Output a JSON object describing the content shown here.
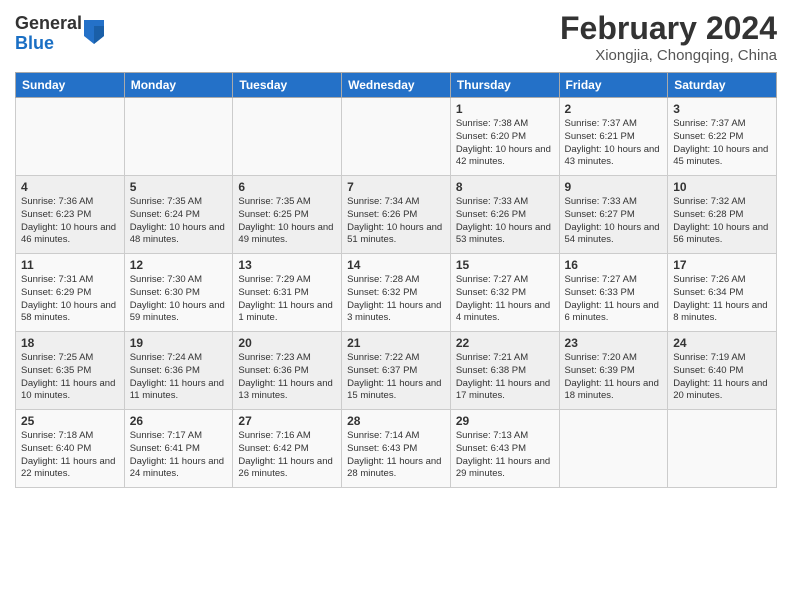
{
  "logo": {
    "text_general": "General",
    "text_blue": "Blue"
  },
  "header": {
    "title": "February 2024",
    "subtitle": "Xiongjia, Chongqing, China"
  },
  "weekdays": [
    "Sunday",
    "Monday",
    "Tuesday",
    "Wednesday",
    "Thursday",
    "Friday",
    "Saturday"
  ],
  "weeks": [
    [
      {
        "day": "",
        "info": ""
      },
      {
        "day": "",
        "info": ""
      },
      {
        "day": "",
        "info": ""
      },
      {
        "day": "",
        "info": ""
      },
      {
        "day": "1",
        "info": "Sunrise: 7:38 AM\nSunset: 6:20 PM\nDaylight: 10 hours and 42 minutes."
      },
      {
        "day": "2",
        "info": "Sunrise: 7:37 AM\nSunset: 6:21 PM\nDaylight: 10 hours and 43 minutes."
      },
      {
        "day": "3",
        "info": "Sunrise: 7:37 AM\nSunset: 6:22 PM\nDaylight: 10 hours and 45 minutes."
      }
    ],
    [
      {
        "day": "4",
        "info": "Sunrise: 7:36 AM\nSunset: 6:23 PM\nDaylight: 10 hours and 46 minutes."
      },
      {
        "day": "5",
        "info": "Sunrise: 7:35 AM\nSunset: 6:24 PM\nDaylight: 10 hours and 48 minutes."
      },
      {
        "day": "6",
        "info": "Sunrise: 7:35 AM\nSunset: 6:25 PM\nDaylight: 10 hours and 49 minutes."
      },
      {
        "day": "7",
        "info": "Sunrise: 7:34 AM\nSunset: 6:26 PM\nDaylight: 10 hours and 51 minutes."
      },
      {
        "day": "8",
        "info": "Sunrise: 7:33 AM\nSunset: 6:26 PM\nDaylight: 10 hours and 53 minutes."
      },
      {
        "day": "9",
        "info": "Sunrise: 7:33 AM\nSunset: 6:27 PM\nDaylight: 10 hours and 54 minutes."
      },
      {
        "day": "10",
        "info": "Sunrise: 7:32 AM\nSunset: 6:28 PM\nDaylight: 10 hours and 56 minutes."
      }
    ],
    [
      {
        "day": "11",
        "info": "Sunrise: 7:31 AM\nSunset: 6:29 PM\nDaylight: 10 hours and 58 minutes."
      },
      {
        "day": "12",
        "info": "Sunrise: 7:30 AM\nSunset: 6:30 PM\nDaylight: 10 hours and 59 minutes."
      },
      {
        "day": "13",
        "info": "Sunrise: 7:29 AM\nSunset: 6:31 PM\nDaylight: 11 hours and 1 minute."
      },
      {
        "day": "14",
        "info": "Sunrise: 7:28 AM\nSunset: 6:32 PM\nDaylight: 11 hours and 3 minutes."
      },
      {
        "day": "15",
        "info": "Sunrise: 7:27 AM\nSunset: 6:32 PM\nDaylight: 11 hours and 4 minutes."
      },
      {
        "day": "16",
        "info": "Sunrise: 7:27 AM\nSunset: 6:33 PM\nDaylight: 11 hours and 6 minutes."
      },
      {
        "day": "17",
        "info": "Sunrise: 7:26 AM\nSunset: 6:34 PM\nDaylight: 11 hours and 8 minutes."
      }
    ],
    [
      {
        "day": "18",
        "info": "Sunrise: 7:25 AM\nSunset: 6:35 PM\nDaylight: 11 hours and 10 minutes."
      },
      {
        "day": "19",
        "info": "Sunrise: 7:24 AM\nSunset: 6:36 PM\nDaylight: 11 hours and 11 minutes."
      },
      {
        "day": "20",
        "info": "Sunrise: 7:23 AM\nSunset: 6:36 PM\nDaylight: 11 hours and 13 minutes."
      },
      {
        "day": "21",
        "info": "Sunrise: 7:22 AM\nSunset: 6:37 PM\nDaylight: 11 hours and 15 minutes."
      },
      {
        "day": "22",
        "info": "Sunrise: 7:21 AM\nSunset: 6:38 PM\nDaylight: 11 hours and 17 minutes."
      },
      {
        "day": "23",
        "info": "Sunrise: 7:20 AM\nSunset: 6:39 PM\nDaylight: 11 hours and 18 minutes."
      },
      {
        "day": "24",
        "info": "Sunrise: 7:19 AM\nSunset: 6:40 PM\nDaylight: 11 hours and 20 minutes."
      }
    ],
    [
      {
        "day": "25",
        "info": "Sunrise: 7:18 AM\nSunset: 6:40 PM\nDaylight: 11 hours and 22 minutes."
      },
      {
        "day": "26",
        "info": "Sunrise: 7:17 AM\nSunset: 6:41 PM\nDaylight: 11 hours and 24 minutes."
      },
      {
        "day": "27",
        "info": "Sunrise: 7:16 AM\nSunset: 6:42 PM\nDaylight: 11 hours and 26 minutes."
      },
      {
        "day": "28",
        "info": "Sunrise: 7:14 AM\nSunset: 6:43 PM\nDaylight: 11 hours and 28 minutes."
      },
      {
        "day": "29",
        "info": "Sunrise: 7:13 AM\nSunset: 6:43 PM\nDaylight: 11 hours and 29 minutes."
      },
      {
        "day": "",
        "info": ""
      },
      {
        "day": "",
        "info": ""
      }
    ]
  ]
}
